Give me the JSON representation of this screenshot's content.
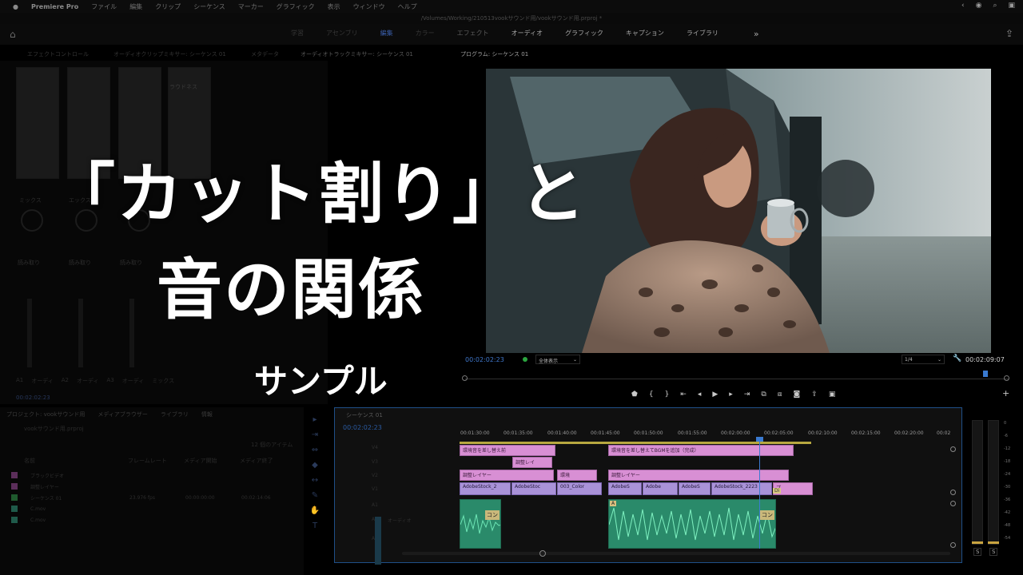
{
  "menubar": {
    "app": "Premiere Pro",
    "items": [
      "ファイル",
      "編集",
      "クリップ",
      "シーケンス",
      "マーカー",
      "グラフィック",
      "表示",
      "ウィンドウ",
      "ヘルプ"
    ]
  },
  "titlebar": {
    "path": "/Volumes/Working/210513vookサウンド用/vookサウンド用.prproj *"
  },
  "workspaces": {
    "tabs": [
      "学習",
      "アセンブリ",
      "編集",
      "カラー",
      "エフェクト",
      "オーディオ",
      "グラフィック",
      "キャプション",
      "ライブラリ"
    ],
    "active": "編集",
    "more": "»"
  },
  "panel_tabs": {
    "left": [
      "エフェクトコントロール",
      "オーディオクリップミキサー: シーケンス 01",
      "メタデータ",
      "オーディオトラックミキサー: シーケンス 01"
    ],
    "program": "プログラム: シーケンス 01"
  },
  "mixer": {
    "loudness_label": "ラウドネス",
    "pan_labels": [
      "ミックス",
      "エックス"
    ],
    "read_labels": [
      "読み取り",
      "読み取り",
      "読み取り"
    ],
    "track_labels": [
      "A1",
      "オーディ",
      "A2",
      "オーディ",
      "A3",
      "オーディ",
      "ミックス"
    ],
    "timecode": "00:02:02:23"
  },
  "overlay": {
    "title_line1": "「カット割り」と",
    "title_line2": "音の関係",
    "subtitle": "サンプル"
  },
  "program_monitor": {
    "timecode_left": "00:02:02:23",
    "fit": "全体表示",
    "resolution": "1/4",
    "timecode_right": "00:02:09:07"
  },
  "project": {
    "tabs": [
      "プロジェクト: vookサウンド用",
      "メディアブラウザー",
      "ライブラリ",
      "情報"
    ],
    "file": "vookサウンド用.prproj",
    "items_count": "12 個のアイテム",
    "columns": [
      "名前",
      "フレームレート",
      "メディア開始",
      "メディア終了"
    ],
    "rows": [
      {
        "name": "ブラックビデオ",
        "fps": "",
        "start": "",
        "end": ""
      },
      {
        "name": "調整レイヤー",
        "fps": "",
        "start": "",
        "end": ""
      },
      {
        "name": "シーケンス 01",
        "fps": "23.976 fps",
        "start": "00:00:00:00",
        "end": "00:02:14:06"
      },
      {
        "name": "C.mov",
        "fps": "",
        "start": "",
        "end": ""
      },
      {
        "name": "C.mov",
        "fps": "",
        "start": "",
        "end": ""
      }
    ]
  },
  "timeline": {
    "tab": "シーケンス 01",
    "timecode": "00:02:02:23",
    "ruler": [
      "00:01:30:00",
      "00:01:35:00",
      "00:01:40:00",
      "00:01:45:00",
      "00:01:50:00",
      "00:01:55:00",
      "00:02:00:00",
      "00:02:05:00",
      "00:02:10:00",
      "00:02:15:00",
      "00:02:20:00",
      "00:02"
    ],
    "clips": {
      "v4a": "環境音を差し替え前",
      "v4b": "環境音を差し替えてBGMを追加（完成）",
      "v3": "調整レイ",
      "v2a": "調整レイヤー",
      "v2b": "環境",
      "v2c": "調整レイヤー",
      "v1a": "AdobeStock_2",
      "v1b": "AdobeStoc",
      "v1c": "003_Color",
      "v1d": "AdobeS",
      "v1e": "Adobe",
      "v1f": "AdobeS",
      "v1g": "AdobeStock_2223",
      "v1h": "プ",
      "a_c1": "コン",
      "a_c2": "コン",
      "marker_a": "A",
      "dissolve": "Di"
    },
    "track_labels": [
      "V4",
      "V3",
      "V2",
      "V1",
      "A1",
      "A2",
      "A3"
    ],
    "audio_label": "オーディオ"
  },
  "meter_labels": [
    "S",
    "S"
  ],
  "meter_scale": [
    "0",
    "-6",
    "-12",
    "-18",
    "-24",
    "-30",
    "-36",
    "-42",
    "-48",
    "-54"
  ]
}
